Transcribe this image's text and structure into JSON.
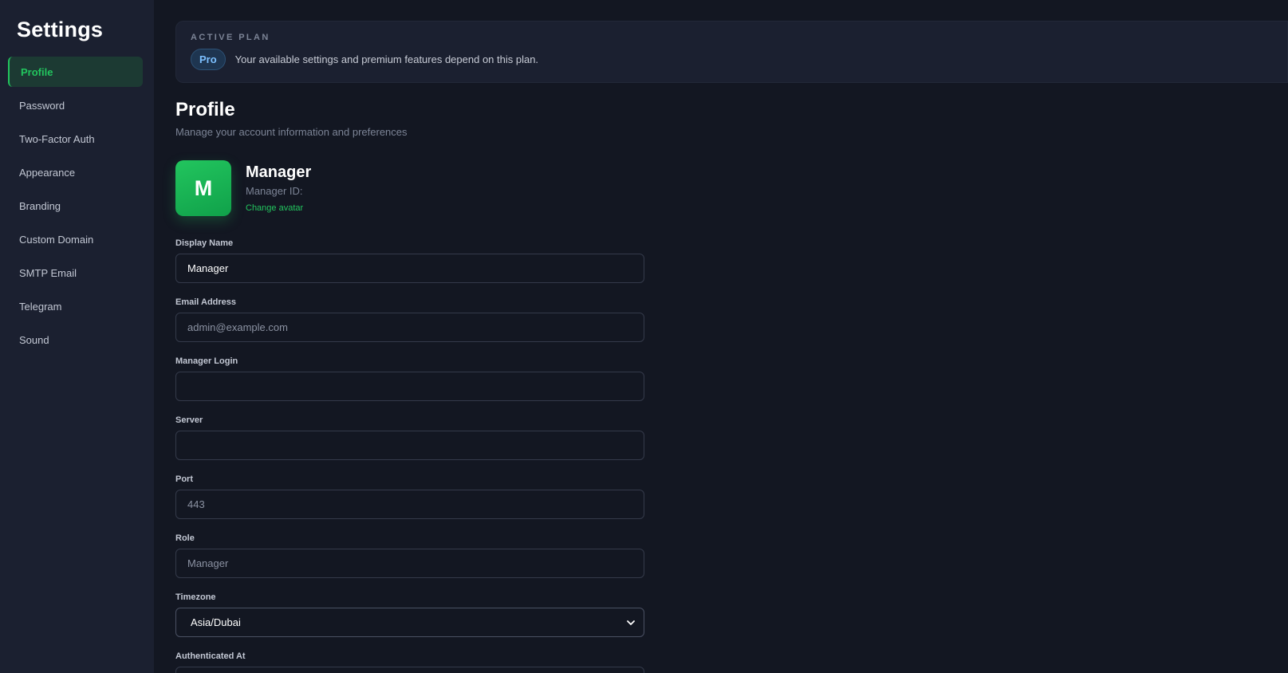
{
  "sidebar": {
    "title": "Settings",
    "items": [
      {
        "label": "Profile",
        "active": true
      },
      {
        "label": "Password"
      },
      {
        "label": "Two-Factor Auth"
      },
      {
        "label": "Appearance"
      },
      {
        "label": "Branding"
      },
      {
        "label": "Custom Domain"
      },
      {
        "label": "SMTP Email"
      },
      {
        "label": "Telegram"
      },
      {
        "label": "Sound"
      }
    ]
  },
  "plan": {
    "label": "ACTIVE PLAN",
    "badge": "Pro",
    "description": "Your available settings and premium features depend on this plan."
  },
  "page": {
    "title": "Profile",
    "subtitle": "Manage your account information and preferences"
  },
  "profile": {
    "avatar_letter": "M",
    "name": "Manager",
    "id_label": "Manager ID:",
    "change_avatar": "Change avatar"
  },
  "form": {
    "display_name": {
      "label": "Display Name",
      "value": "Manager"
    },
    "email": {
      "label": "Email Address",
      "placeholder": "admin@example.com"
    },
    "manager_login": {
      "label": "Manager Login",
      "value": ""
    },
    "server": {
      "label": "Server",
      "value": ""
    },
    "port": {
      "label": "Port",
      "placeholder": "443"
    },
    "role": {
      "label": "Role",
      "value": "Manager"
    },
    "timezone": {
      "label": "Timezone",
      "value": "Asia/Dubai"
    },
    "authenticated_at": {
      "label": "Authenticated At"
    }
  },
  "colors": {
    "accent": "#22c55e",
    "background": "#131722",
    "sidebar": "#1b2030"
  }
}
